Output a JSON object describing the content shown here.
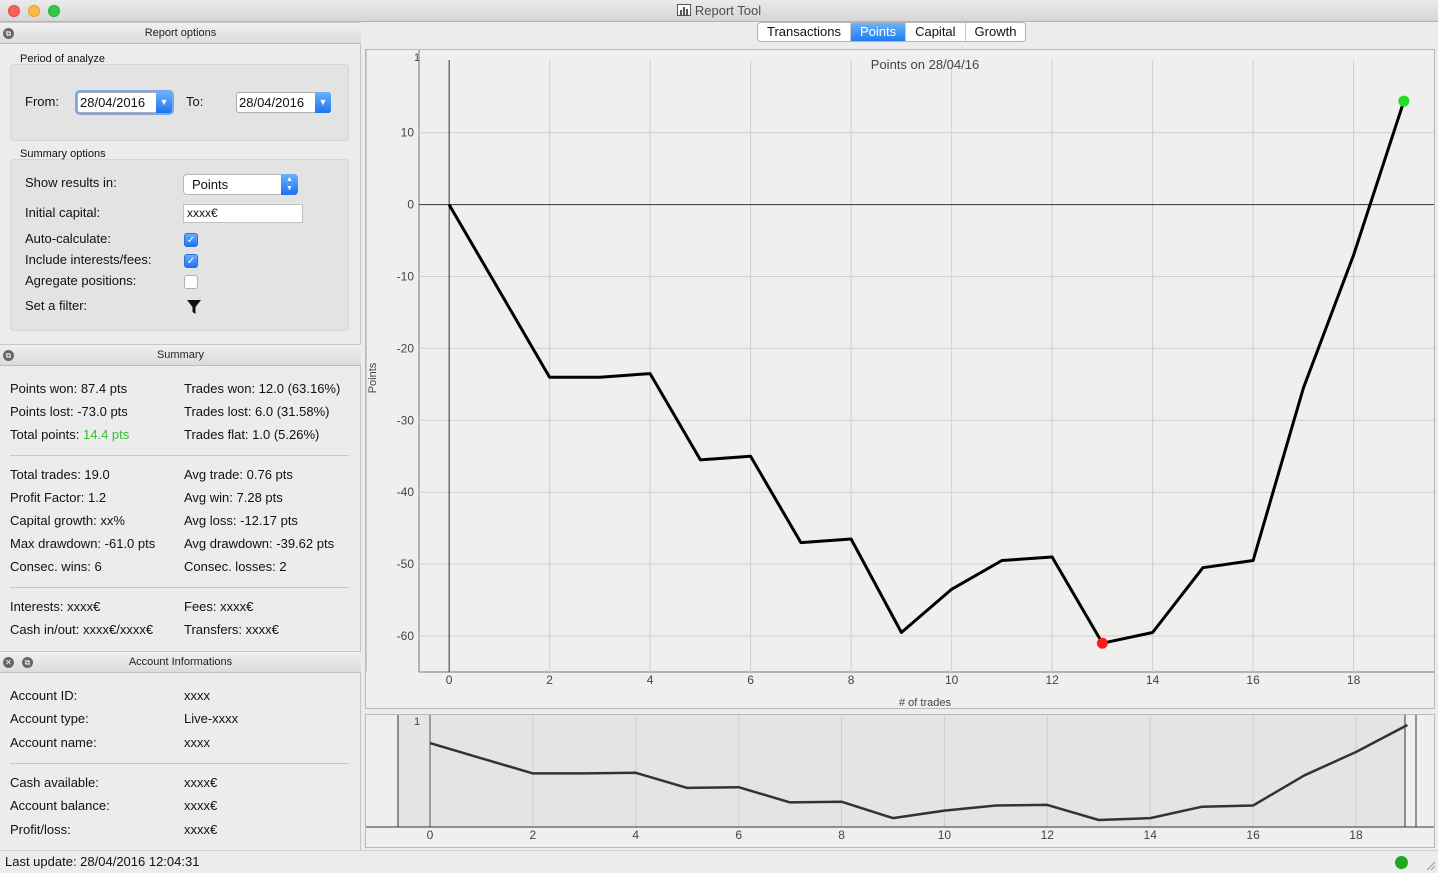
{
  "window": {
    "title": "Report Tool"
  },
  "report_options": {
    "header": "Report options",
    "period_title": "Period of analyze",
    "from_label": "From:",
    "from_value": "28/04/2016",
    "to_label": "To:",
    "to_value": "28/04/2016",
    "summary_title": "Summary options",
    "show_results_label": "Show results in:",
    "show_results_value": "Points",
    "initial_capital_label": "Initial capital:",
    "initial_capital_value": "xxxx€",
    "auto_calc_label": "Auto-calculate:",
    "auto_calc_checked": true,
    "include_fees_label": "Include interests/fees:",
    "include_fees_checked": true,
    "aggregate_label": "Agregate positions:",
    "aggregate_checked": false,
    "filter_label": "Set a filter:"
  },
  "summary": {
    "header": "Summary",
    "points_won": "Points won: 87.4 pts",
    "trades_won": "Trades won: 12.0 (63.16%)",
    "points_lost": "Points lost: -73.0 pts",
    "trades_lost": "Trades lost: 6.0 (31.58%)",
    "total_points_label": "Total points:",
    "total_points_value": "14.4 pts",
    "trades_flat": "Trades flat: 1.0 (5.26%)",
    "total_trades": "Total trades: 19.0",
    "avg_trade": "Avg trade: 0.76 pts",
    "profit_factor": "Profit Factor: 1.2",
    "avg_win": "Avg win: 7.28 pts",
    "capital_growth": "Capital growth: xx%",
    "avg_loss": "Avg loss: -12.17 pts",
    "max_drawdown": "Max drawdown: -61.0 pts",
    "avg_drawdown": "Avg drawdown: -39.62 pts",
    "consec_wins": "Consec. wins: 6",
    "consec_losses": "Consec. losses: 2",
    "interests": "Interests: xxxx€",
    "fees": "Fees: xxxx€",
    "cash_inout": "Cash in/out: xxxx€/xxxx€",
    "transfers": "Transfers: xxxx€"
  },
  "account": {
    "header": "Account Informations",
    "id_label": "Account ID:",
    "id_value": "xxxx",
    "type_label": "Account type:",
    "type_value": "Live-xxxx",
    "name_label": "Account name:",
    "name_value": "xxxx",
    "cash_label": "Cash available:",
    "cash_value": "xxxx€",
    "balance_label": "Account balance:",
    "balance_value": "xxxx€",
    "pl_label": "Profit/loss:",
    "pl_value": "xxxx€"
  },
  "status": {
    "text": "Last update: 28/04/2016 12:04:31"
  },
  "tabs": [
    {
      "label": "Transactions",
      "active": false
    },
    {
      "label": "Points",
      "active": true
    },
    {
      "label": "Capital",
      "active": false
    },
    {
      "label": "Growth",
      "active": false
    }
  ],
  "colors": {
    "accent": "#1f7cf2",
    "positive": "#2fbf2f",
    "min_marker": "#ff1a1a",
    "max_marker": "#22e022",
    "line": "#000000"
  },
  "chart_data": {
    "type": "line",
    "title": "Points on 28/04/16",
    "xlabel": "# of trades",
    "ylabel": "Points",
    "corner_label": "1",
    "x": [
      0,
      1,
      2,
      3,
      4,
      5,
      6,
      7,
      8,
      9,
      10,
      11,
      12,
      13,
      14,
      15,
      16,
      17,
      18,
      19
    ],
    "series": [
      {
        "values": [
          0,
          -12,
          -24,
          -24,
          -23.5,
          -35.5,
          -35,
          -47,
          -46.5,
          -59.5,
          -53.5,
          -49.5,
          -49,
          -61,
          -59.5,
          -50.5,
          -49.5,
          -25.5,
          -7,
          14.4
        ]
      }
    ],
    "x_ticks": [
      0,
      2,
      4,
      6,
      8,
      10,
      12,
      14,
      16,
      18
    ],
    "y_ticks": [
      10,
      0,
      -10,
      -20,
      -30,
      -40,
      -50,
      -60
    ],
    "xlim": [
      -0.6,
      19.6
    ],
    "ylim": [
      -65,
      19
    ],
    "min_point": {
      "x": 13,
      "y": -61
    },
    "max_point": {
      "x": 19,
      "y": 14.4
    },
    "grid": true,
    "overview": {
      "x_ticks": [
        0,
        2,
        4,
        6,
        8,
        10,
        12,
        14,
        16,
        18
      ],
      "corner_label": "1"
    }
  }
}
